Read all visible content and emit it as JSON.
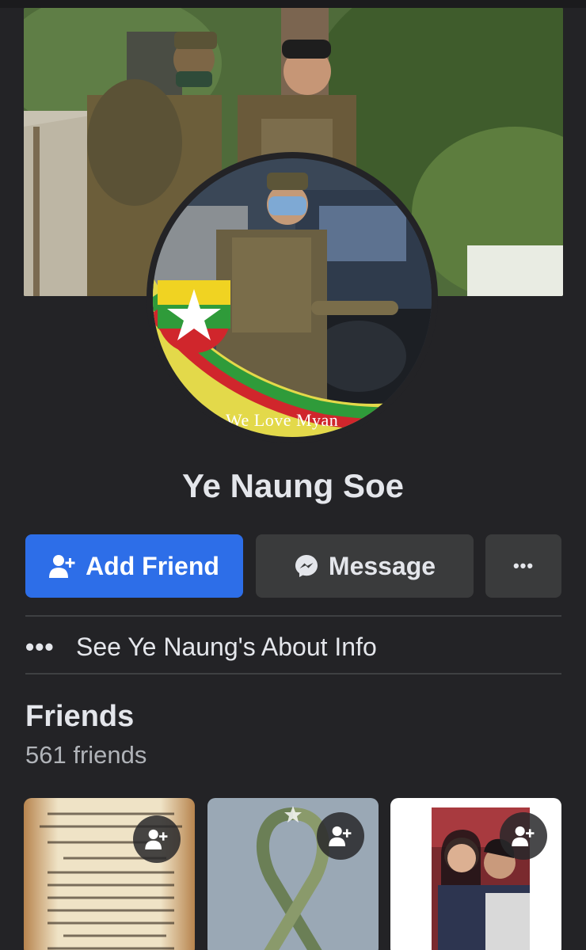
{
  "profile": {
    "name": "Ye Naung Soe",
    "avatar_caption": "We Love Myan"
  },
  "actions": {
    "add_friend_label": "Add Friend",
    "message_label": "Message",
    "more_label": "•••"
  },
  "about": {
    "dots": "•••",
    "label": "See Ye Naung's About Info"
  },
  "friends": {
    "title": "Friends",
    "count_label": "561 friends",
    "cards": [
      {
        "icon": "add-friend-icon"
      },
      {
        "icon": "add-friend-icon"
      },
      {
        "icon": "add-friend-icon"
      }
    ]
  },
  "colors": {
    "background": "#232326",
    "primary_button": "#2d6ee8",
    "secondary_button": "#3a3b3c",
    "text": "#e4e6eb",
    "muted_text": "#b0b3b8"
  }
}
